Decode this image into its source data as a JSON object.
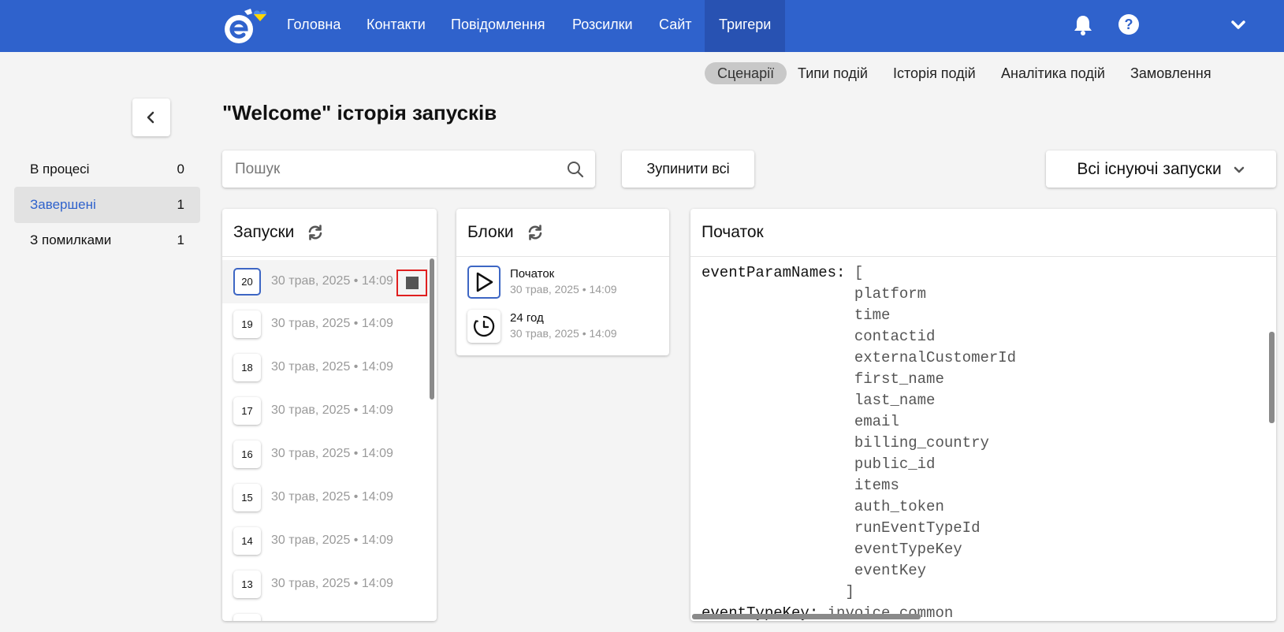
{
  "nav": {
    "items": [
      {
        "label": "Головна"
      },
      {
        "label": "Контакти"
      },
      {
        "label": "Повідомлення"
      },
      {
        "label": "Розсилки"
      },
      {
        "label": "Сайт"
      },
      {
        "label": "Тригери"
      }
    ],
    "active": "Тригери",
    "icons": [
      "bell-icon",
      "help-icon",
      "chevron-down-icon"
    ]
  },
  "subnav": {
    "items": [
      {
        "label": "Сценарії"
      },
      {
        "label": "Типи подій"
      },
      {
        "label": "Історія подій"
      },
      {
        "label": "Аналітика подій"
      },
      {
        "label": "Замовлення"
      }
    ],
    "active": "Сценарії"
  },
  "page": {
    "title": "\"Welcome\" історія запусків"
  },
  "filters": [
    {
      "label": "В процесі",
      "count": "0"
    },
    {
      "label": "Завершені",
      "count": "1"
    },
    {
      "label": "З помилками",
      "count": "1"
    }
  ],
  "toolbar": {
    "search_placeholder": "Пошук",
    "stop_all": "Зупинити всі",
    "runs_filter": "Всі існуючі запуски"
  },
  "runs": {
    "title": "Запуски",
    "items": [
      {
        "num": "20",
        "date": "30 трав, 2025 • 14:09"
      },
      {
        "num": "19",
        "date": "30 трав, 2025 • 14:09"
      },
      {
        "num": "18",
        "date": "30 трав, 2025 • 14:09"
      },
      {
        "num": "17",
        "date": "30 трав, 2025 • 14:09"
      },
      {
        "num": "16",
        "date": "30 трав, 2025 • 14:09"
      },
      {
        "num": "15",
        "date": "30 трав, 2025 • 14:09"
      },
      {
        "num": "14",
        "date": "30 трав, 2025 • 14:09"
      },
      {
        "num": "13",
        "date": "30 трав, 2025 • 14:09"
      }
    ]
  },
  "blocks": {
    "title": "Блоки",
    "items": [
      {
        "name": "Початок",
        "date": "30 трав, 2025 • 14:09",
        "icon": "play-icon"
      },
      {
        "name": "24 год",
        "date": "30 трав, 2025 • 14:09",
        "icon": "timer-icon"
      }
    ]
  },
  "detail": {
    "title": "Початок",
    "key1": "eventParamNames:",
    "open_bracket": "[",
    "params": [
      "platform",
      "time",
      "contactid",
      "externalCustomerId",
      "first_name",
      "last_name",
      "email",
      "billing_country",
      "public_id",
      "items",
      "auth_token",
      "runEventTypeId",
      "eventTypeKey",
      "eventKey"
    ],
    "close_bracket": "]",
    "key2": "eventTypeKey:",
    "value2": "invoice_common"
  },
  "colors": {
    "brand": "#2f62cc",
    "highlight": "#e01f1f"
  }
}
